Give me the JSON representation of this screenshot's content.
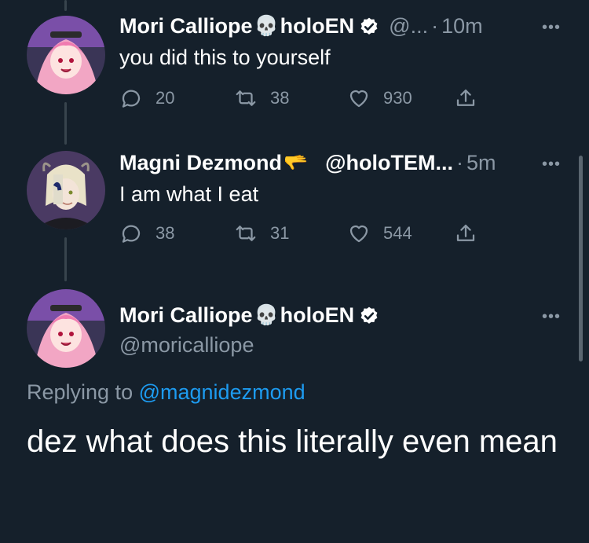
{
  "colors": {
    "background": "#15202b",
    "text_primary": "#ffffff",
    "text_secondary": "#8b98a5",
    "accent": "#1d9bf0",
    "verified": "#ffffff"
  },
  "tweets": [
    {
      "display_name": "Mori Calliope",
      "emoji": "💀",
      "name_suffix": "holoEN",
      "handle": "@...",
      "dot": "·",
      "time": "10m",
      "text": "you did this to yourself",
      "replies": "20",
      "retweets": "38",
      "likes": "930",
      "more": "•••"
    },
    {
      "display_name": "Magni Dezmond",
      "emoji": "🫳",
      "handle": "@holoTEM...",
      "dot": "·",
      "time": "5m",
      "text": "I am what I eat",
      "replies": "38",
      "retweets": "31",
      "likes": "544",
      "more": "•••"
    }
  ],
  "focus_tweet": {
    "display_name": "Mori Calliope",
    "emoji": "💀",
    "name_suffix": "holoEN",
    "handle": "@moricalliope",
    "more": "•••",
    "replying_prefix": "Replying to",
    "replying_mention": "@magnidezmond",
    "text": "dez what does this literally even mean"
  }
}
